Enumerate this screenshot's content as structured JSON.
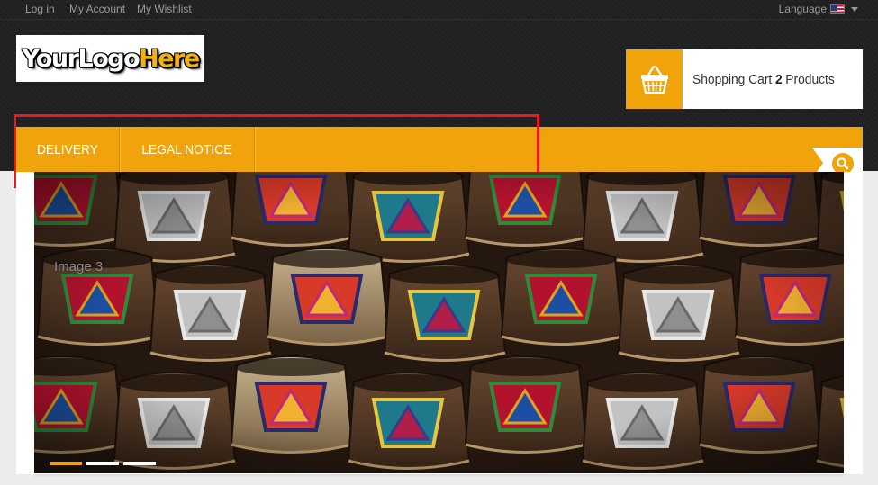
{
  "topbar": {
    "links": [
      "Log in",
      "My Account",
      "My Wishlist"
    ],
    "language_label": "Language"
  },
  "logo": {
    "part1": "Your",
    "part2": "Logo",
    "part3": "Here"
  },
  "cart": {
    "label": "Shopping Cart",
    "count": "2",
    "unit": "Products"
  },
  "nav": {
    "items": [
      "DELIVERY",
      "LEGAL NOTICE"
    ]
  },
  "slider": {
    "caption": "Image 3",
    "slide_count": 3,
    "active_index": 0
  },
  "colors": {
    "accent": "#f0a30a",
    "header_bg": "#1f1f1f",
    "highlight": "#e31b23"
  }
}
